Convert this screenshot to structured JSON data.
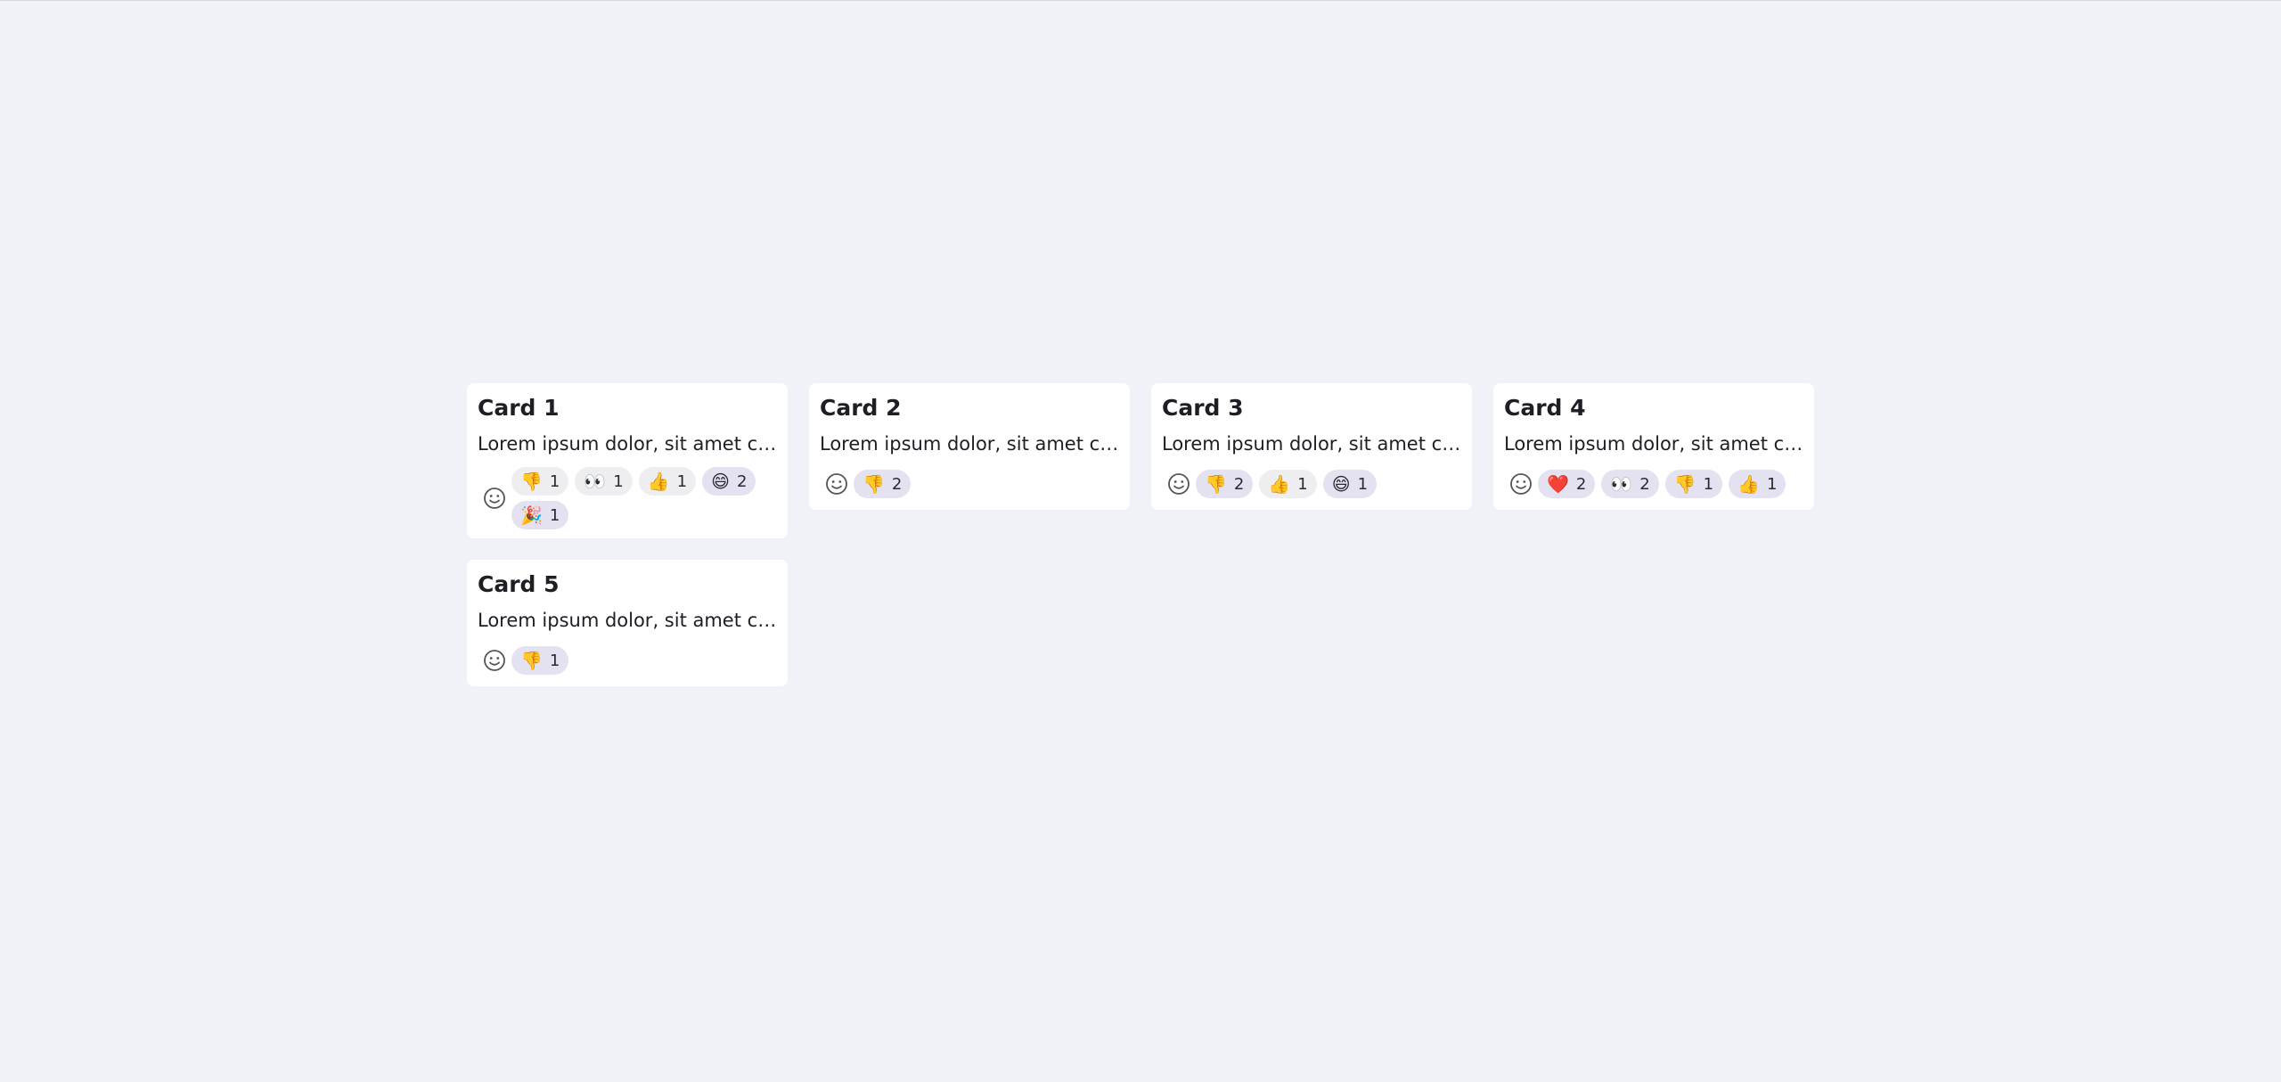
{
  "cards": [
    {
      "title": "Card 1",
      "description": "Lorem ipsum dolor, sit amet consectetur adipisicing elit.",
      "reactions": [
        {
          "emoji": "👎",
          "count": "1",
          "active": false
        },
        {
          "emoji": "👀",
          "count": "1",
          "active": false
        },
        {
          "emoji": "👍",
          "count": "1",
          "active": false
        },
        {
          "emoji": "😄",
          "count": "2",
          "active": true
        },
        {
          "emoji": "🎉",
          "count": "1",
          "active": true
        }
      ]
    },
    {
      "title": "Card 2",
      "description": "Lorem ipsum dolor, sit amet consectetur adipisicing elit.",
      "reactions": [
        {
          "emoji": "👎",
          "count": "2",
          "active": true
        }
      ]
    },
    {
      "title": "Card 3",
      "description": "Lorem ipsum dolor, sit amet consectetur adipisicing elit.",
      "reactions": [
        {
          "emoji": "👎",
          "count": "2",
          "active": true
        },
        {
          "emoji": "👍",
          "count": "1",
          "active": false
        },
        {
          "emoji": "😄",
          "count": "1",
          "active": true
        }
      ]
    },
    {
      "title": "Card 4",
      "description": "Lorem ipsum dolor, sit amet consectetur adipisicing elit.",
      "reactions": [
        {
          "emoji": "❤️",
          "count": "2",
          "active": true
        },
        {
          "emoji": "👀",
          "count": "2",
          "active": true
        },
        {
          "emoji": "👎",
          "count": "1",
          "active": true
        },
        {
          "emoji": "👍",
          "count": "1",
          "active": true
        }
      ]
    },
    {
      "title": "Card 5",
      "description": "Lorem ipsum dolor, sit amet consectetur adipisicing elit.",
      "reactions": [
        {
          "emoji": "👎",
          "count": "1",
          "active": true
        }
      ]
    }
  ],
  "icons": {
    "add_reaction": "smiley-face-icon"
  },
  "colors": {
    "background": "#f1f2f7",
    "card": "#ffffff",
    "chip": "#eeeef1",
    "chip_active": "#e4e1f1"
  }
}
